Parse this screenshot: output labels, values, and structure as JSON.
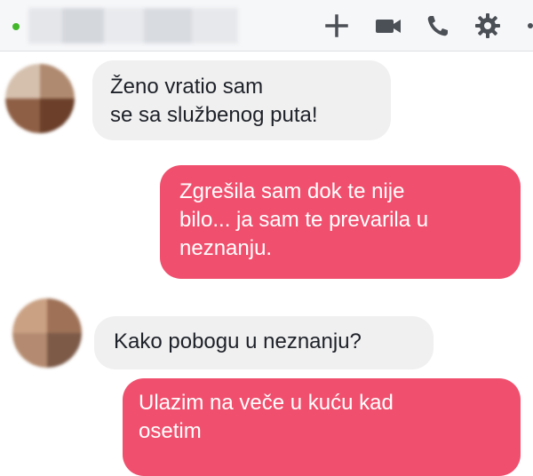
{
  "header": {
    "status_color": "#42b72a",
    "icons": [
      "plus-icon",
      "video-camera-icon",
      "phone-icon",
      "gear-icon",
      "more-icon"
    ]
  },
  "messages": [
    {
      "direction": "incoming",
      "text_lines": [
        "Ženo vratio sam",
        "se sa službenog puta!"
      ]
    },
    {
      "direction": "outgoing",
      "text_lines": [
        "Zgrešila sam dok te nije",
        "bilo... ja sam te prevarila u",
        "neznanju."
      ]
    },
    {
      "direction": "incoming",
      "text_lines": [
        "Kako pobogu u neznanju?"
      ]
    },
    {
      "direction": "outgoing",
      "text_lines": [
        "Ulazim na veče u kuću kad",
        "osetim"
      ]
    }
  ],
  "colors": {
    "outgoing_bubble": "#f0506e",
    "incoming_bubble": "#f1f0f0",
    "header_icons": "#4b4f56"
  }
}
